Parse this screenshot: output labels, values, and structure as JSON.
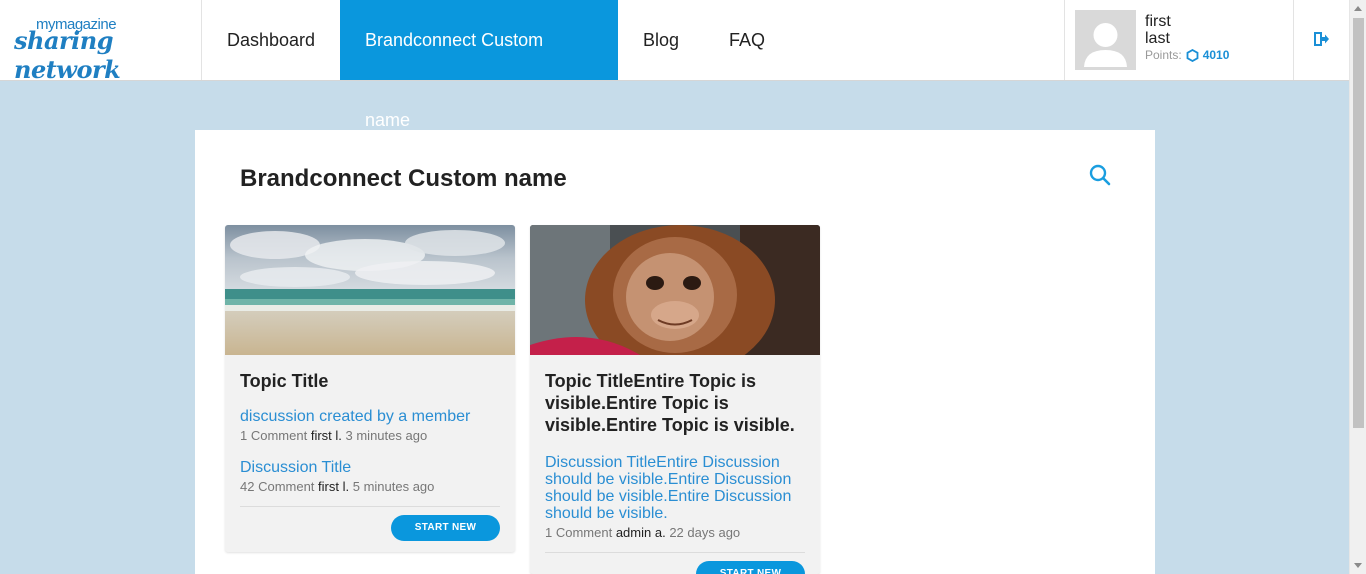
{
  "header": {
    "logo_small": "mymagazine",
    "logo_big": "sharing network",
    "nav": [
      {
        "label": "Dashboard"
      },
      {
        "label": "Brandconnect Custom name"
      },
      {
        "label": "Blog"
      },
      {
        "label": "FAQ"
      }
    ],
    "user": {
      "first": "first",
      "last": "last",
      "points_label": "Points:",
      "points_value": "4010"
    }
  },
  "main": {
    "title": "Brandconnect Custom name",
    "cards": [
      {
        "image": "beach-photo",
        "title": "Topic Title",
        "discussions": [
          {
            "title": "discussion created by a member",
            "comments": "1 Comment",
            "author": "first l.",
            "time": "3 minutes ago"
          },
          {
            "title": "Discussion Title",
            "comments": "42 Comment",
            "author": "first l.",
            "time": "5 minutes ago"
          }
        ],
        "button": "START NEW"
      },
      {
        "image": "orangutan-photo",
        "title": "Topic TitleEntire Topic is visible.Entire Topic is visible.Entire Topic is visible.",
        "discussions": [
          {
            "title": "Discussion TitleEntire Discussion should be visible.Entire Discussion should be visible.Entire Discussion should be visible.",
            "comments": "1 Comment",
            "author": "admin a.",
            "time": "22 days ago"
          }
        ],
        "button": "START NEW"
      }
    ]
  },
  "colors": {
    "accent": "#0a97dd",
    "link": "#2a8ed3",
    "background": "#c6dcea"
  }
}
